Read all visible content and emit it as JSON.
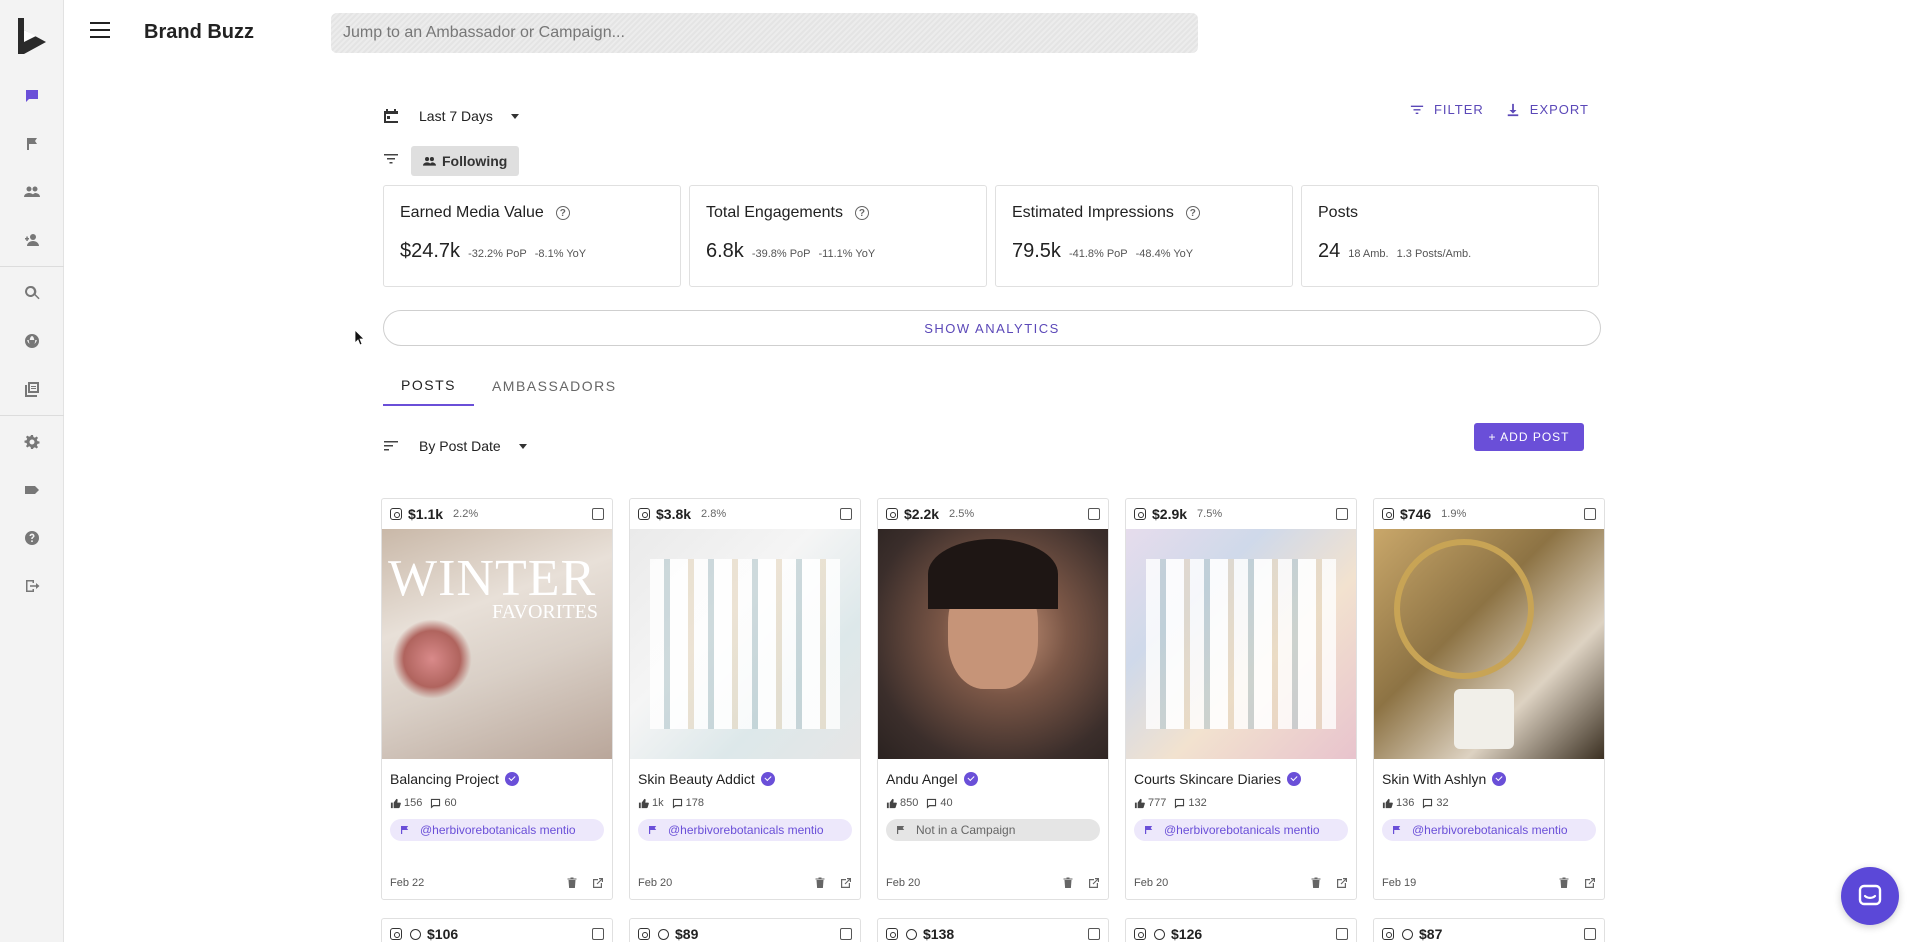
{
  "app": {
    "title": "Brand Buzz"
  },
  "search": {
    "placeholder": "Jump to an Ambassador or Campaign..."
  },
  "rail": {
    "items": [
      "chat-icon",
      "flag-icon",
      "people-icon",
      "person-add-icon",
      "search-icon",
      "globe-icon",
      "library-icon",
      "gear-icon",
      "label-icon",
      "help-icon",
      "logout-icon"
    ],
    "active": "chat-icon"
  },
  "toolbar": {
    "date_range": "Last 7 Days",
    "filter_label": "FILTER",
    "export_label": "EXPORT",
    "following_label": "Following"
  },
  "stats": [
    {
      "title": "Earned Media Value",
      "value": "$24.7k",
      "pop": "-32.2% PoP",
      "yoy": "-8.1% YoY",
      "help": true
    },
    {
      "title": "Total Engagements",
      "value": "6.8k",
      "pop": "-39.8% PoP",
      "yoy": "-11.1% YoY",
      "help": true
    },
    {
      "title": "Estimated Impressions",
      "value": "79.5k",
      "pop": "-41.8% PoP",
      "yoy": "-48.4% YoY",
      "help": true
    },
    {
      "title": "Posts",
      "value": "24",
      "pop": "18 Amb.",
      "yoy": "1.3 Posts/Amb.",
      "help": false
    }
  ],
  "show_analytics_label": "SHOW ANALYTICS",
  "tabs": [
    {
      "label": "POSTS",
      "active": true
    },
    {
      "label": "AMBASSADORS",
      "active": false
    }
  ],
  "sort": {
    "label": "By Post Date"
  },
  "add_post_label": "+ ADD POST",
  "posts": [
    {
      "emv": "$1.1k",
      "rate": "2.2%",
      "name": "Balancing Project",
      "likes": "156",
      "comments": "60",
      "campaign": "@herbivorebotanicals mentio",
      "in_campaign": true,
      "date": "Feb 22"
    },
    {
      "emv": "$3.8k",
      "rate": "2.8%",
      "name": "Skin Beauty Addict",
      "likes": "1k",
      "comments": "178",
      "campaign": "@herbivorebotanicals mentio",
      "in_campaign": true,
      "date": "Feb 20"
    },
    {
      "emv": "$2.2k",
      "rate": "2.5%",
      "name": "Andu Angel",
      "likes": "850",
      "comments": "40",
      "campaign": "Not in a Campaign",
      "in_campaign": false,
      "date": "Feb 20"
    },
    {
      "emv": "$2.9k",
      "rate": "7.5%",
      "name": "Courts Skincare Diaries",
      "likes": "777",
      "comments": "132",
      "campaign": "@herbivorebotanicals mentio",
      "in_campaign": true,
      "date": "Feb 20"
    },
    {
      "emv": "$746",
      "rate": "1.9%",
      "name": "Skin With Ashlyn",
      "likes": "136",
      "comments": "32",
      "campaign": "@herbivorebotanicals mentio",
      "in_campaign": true,
      "date": "Feb 19"
    }
  ],
  "image_text": {
    "winter": "WINTER",
    "favorites": "FAVORITES"
  },
  "next_row": [
    {
      "emv": "$106"
    },
    {
      "emv": "$89"
    },
    {
      "emv": "$138"
    },
    {
      "emv": "$126"
    },
    {
      "emv": "$87"
    }
  ],
  "colors": {
    "accent": "#6a4fd8",
    "accent_text": "#5b48b8",
    "chip_bg": "#dfdfdf"
  }
}
